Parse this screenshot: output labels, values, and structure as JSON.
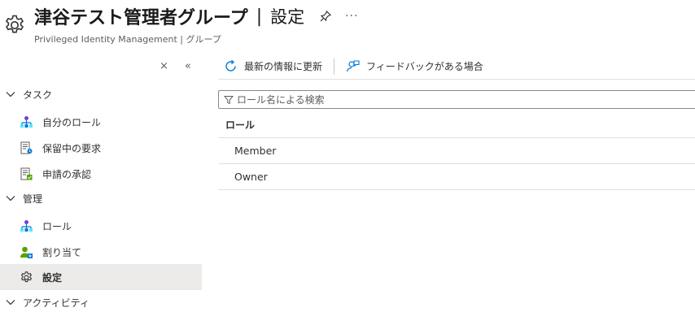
{
  "header": {
    "title": "津谷テスト管理者グループ",
    "separator": "|",
    "section": "設定",
    "subtitle": "Privileged Identity Management | グループ",
    "more": "···"
  },
  "sidebar": {
    "collapse_label": "×",
    "double_chevron": "«",
    "groups": [
      {
        "label": "タスク",
        "items": [
          {
            "label": "自分のロール",
            "icon": "my-roles-icon"
          },
          {
            "label": "保留中の要求",
            "icon": "pending-requests-icon"
          },
          {
            "label": "申請の承認",
            "icon": "approve-requests-icon"
          }
        ]
      },
      {
        "label": "管理",
        "items": [
          {
            "label": "ロール",
            "icon": "roles-icon"
          },
          {
            "label": "割り当て",
            "icon": "assignments-icon"
          },
          {
            "label": "設定",
            "icon": "settings-icon",
            "active": true
          }
        ]
      },
      {
        "label": "アクティビティ",
        "items": []
      }
    ]
  },
  "toolbar": {
    "refresh_label": "最新の情報に更新",
    "feedback_label": "フィードバックがある場合"
  },
  "search": {
    "placeholder": "ロール名による検索"
  },
  "table": {
    "column": "ロール",
    "rows": [
      "Member",
      "Owner"
    ]
  },
  "colors": {
    "accent": "#0078d4",
    "active_bg": "#edebe9",
    "text": "#323130"
  }
}
